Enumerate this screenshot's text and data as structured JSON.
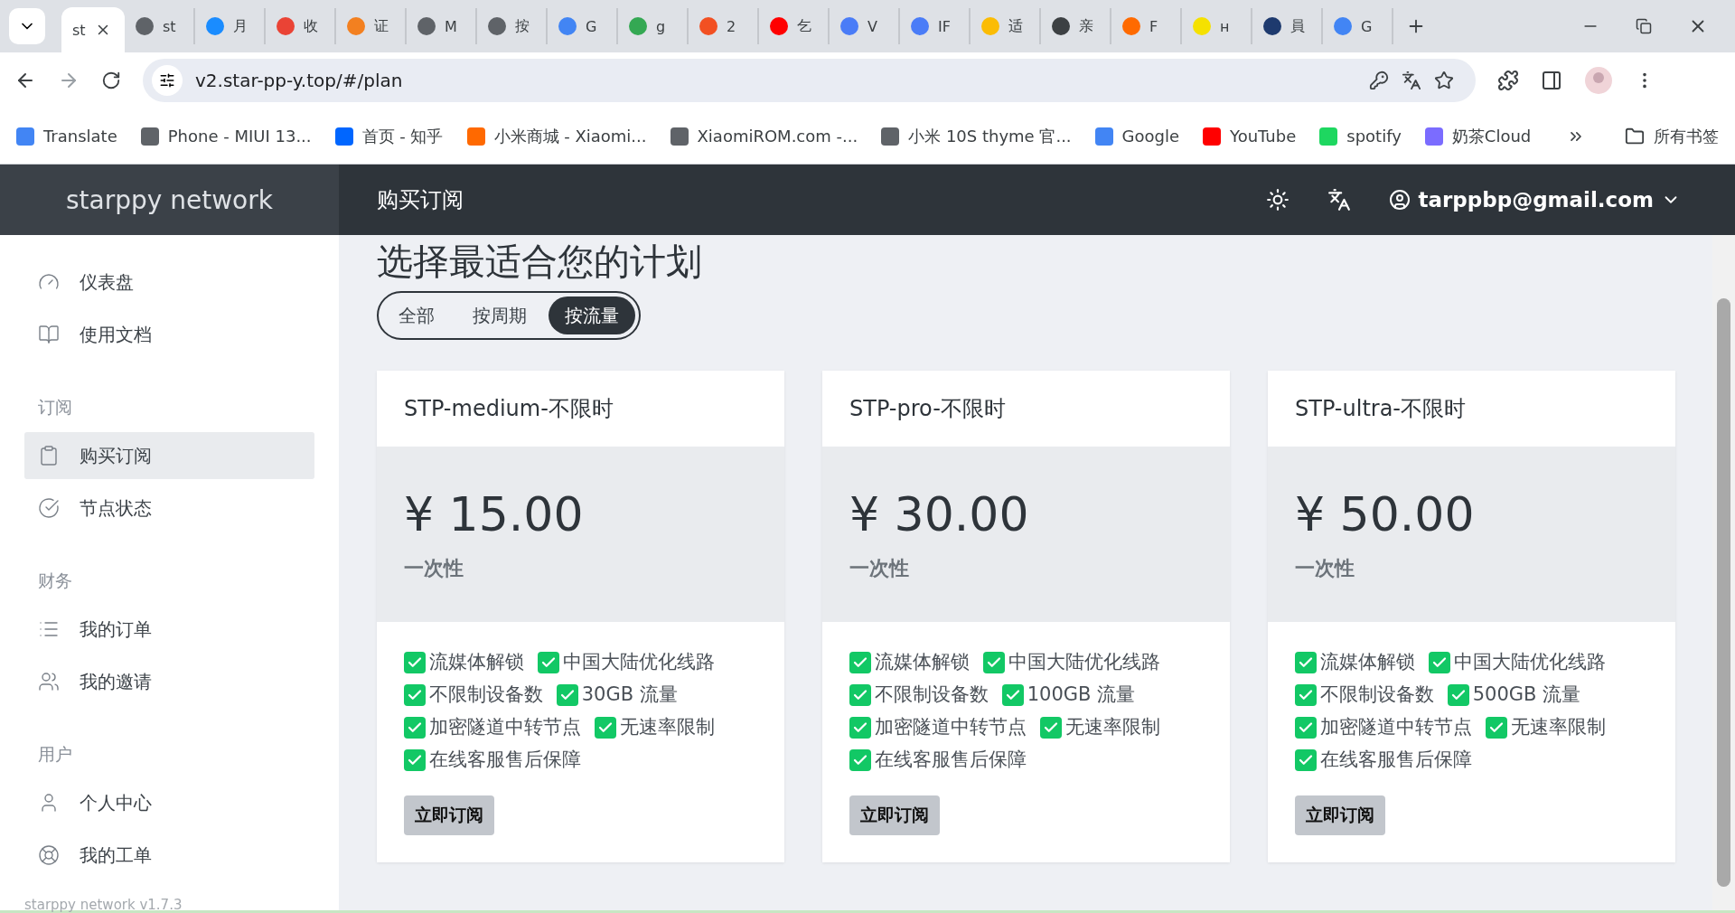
{
  "browser": {
    "tabs": [
      {
        "title": "st",
        "selected": true
      },
      {
        "title": "st",
        "selected": false,
        "color": "#5f6368"
      },
      {
        "title": "月",
        "selected": false,
        "color": "#1a8cff"
      },
      {
        "title": "收",
        "selected": false,
        "color": "#ea4335"
      },
      {
        "title": "证",
        "selected": false,
        "color": "#f38020"
      },
      {
        "title": "M",
        "selected": false,
        "color": "#5f6368"
      },
      {
        "title": "按",
        "selected": false,
        "color": "#5f6368"
      },
      {
        "title": "G",
        "selected": false,
        "color": "#4285f4"
      },
      {
        "title": "g",
        "selected": false,
        "color": "#34a853"
      },
      {
        "title": "2",
        "selected": false,
        "color": "#f25022"
      },
      {
        "title": "乞",
        "selected": false,
        "color": "#ff0000"
      },
      {
        "title": "V",
        "selected": false,
        "color": "#4a7cf7"
      },
      {
        "title": "IF",
        "selected": false,
        "color": "#4a7cf7"
      },
      {
        "title": "适",
        "selected": false,
        "color": "#fbbc04"
      },
      {
        "title": "亲",
        "selected": false,
        "color": "#3c4043"
      },
      {
        "title": "F",
        "selected": false,
        "color": "#ff6a00"
      },
      {
        "title": "н",
        "selected": false,
        "color": "#f5e100"
      },
      {
        "title": "員",
        "selected": false,
        "color": "#1e3a6e"
      },
      {
        "title": "G",
        "selected": false,
        "color": "#4285f4"
      }
    ],
    "url": "v2.star-pp-y.top/#/plan",
    "bookmarks": [
      {
        "label": "Translate",
        "color": "#4285f4"
      },
      {
        "label": "Phone - MIUI 13...",
        "color": "#5f6368"
      },
      {
        "label": "首页 - 知乎",
        "color": "#0066ff"
      },
      {
        "label": "小米商城 - Xiaomi...",
        "color": "#ff6900"
      },
      {
        "label": "XiaomiROM.com -...",
        "color": "#5f6368"
      },
      {
        "label": "小米 10S thyme 官...",
        "color": "#5f6368"
      },
      {
        "label": "Google",
        "color": "#4285f4"
      },
      {
        "label": "YouTube",
        "color": "#ff0000"
      },
      {
        "label": "spotify",
        "color": "#1ed760"
      },
      {
        "label": "奶茶Cloud",
        "color": "#7b6cff"
      }
    ],
    "all_bookmarks": "所有书签"
  },
  "app": {
    "brand": "starppy network",
    "page_title": "购买订阅",
    "user_email": "tarppbp@gmail.com",
    "version": "starppy network v1.7.3"
  },
  "sidebar": {
    "sections": [
      {
        "items": [
          {
            "label": "仪表盘",
            "selected": false
          },
          {
            "label": "使用文档",
            "selected": false
          }
        ]
      },
      {
        "title": "订阅",
        "items": [
          {
            "label": "购买订阅",
            "selected": true
          },
          {
            "label": "节点状态",
            "selected": false
          }
        ]
      },
      {
        "title": "财务",
        "items": [
          {
            "label": "我的订单",
            "selected": false
          },
          {
            "label": "我的邀请",
            "selected": false
          }
        ]
      },
      {
        "title": "用户",
        "items": [
          {
            "label": "个人中心",
            "selected": false
          },
          {
            "label": "我的工单",
            "selected": false
          }
        ]
      }
    ]
  },
  "heading": "选择最适合您的计划",
  "filters": [
    {
      "label": "全部",
      "selected": false
    },
    {
      "label": "按周期",
      "selected": false
    },
    {
      "label": "按流量",
      "selected": true
    }
  ],
  "plans": [
    {
      "name": "STP-medium-不限时",
      "price": "¥ 15.00",
      "period": "一次性",
      "features": [
        "流媒体解锁",
        "中国大陆优化线路",
        "不限制设备数",
        "30GB 流量",
        "加密隧道中转节点",
        "无速率限制",
        "在线客服售后保障"
      ],
      "button": "立即订阅"
    },
    {
      "name": "STP-pro-不限时",
      "price": "¥ 30.00",
      "period": "一次性",
      "features": [
        "流媒体解锁",
        "中国大陆优化线路",
        "不限制设备数",
        "100GB 流量",
        "加密隧道中转节点",
        "无速率限制",
        "在线客服售后保障"
      ],
      "button": "立即订阅"
    },
    {
      "name": "STP-ultra-不限时",
      "price": "¥ 50.00",
      "period": "一次性",
      "features": [
        "流媒体解锁",
        "中国大陆优化线路",
        "不限制设备数",
        "500GB 流量",
        "加密隧道中转节点",
        "无速率限制",
        "在线客服售后保障"
      ],
      "button": "立即订阅"
    }
  ]
}
